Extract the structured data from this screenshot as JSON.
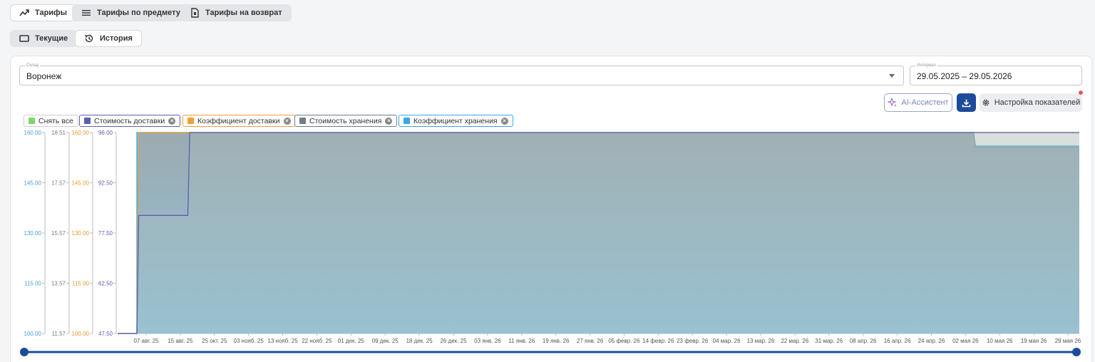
{
  "top_tabs": [
    {
      "label": "Тарифы",
      "icon": "trending-up-icon"
    },
    {
      "label": "Тарифы по предмету",
      "icon": "list-icon"
    },
    {
      "label": "Тарифы на возврат",
      "icon": "document-icon"
    }
  ],
  "sub_tabs": [
    {
      "label": "Текущие",
      "icon": "rectangle-icon"
    },
    {
      "label": "История",
      "icon": "history-icon"
    }
  ],
  "warehouse": {
    "label": "Склад",
    "value": "Воронеж"
  },
  "interval": {
    "label": "Интервал",
    "value": "29.05.2025 – 29.05.2026"
  },
  "buttons": {
    "ai": "AI-Ассистент",
    "settings": "Настройка показателей"
  },
  "legend": [
    {
      "label": "Снять все",
      "color": "#7fd66a",
      "border": "#c9cdd2",
      "removable": false
    },
    {
      "label": "Стоимость доставки",
      "color": "#5b5fb0",
      "border": "#5b5fb0",
      "removable": true
    },
    {
      "label": "Коэффициент доставки",
      "color": "#f0a033",
      "border": "#f0a033",
      "removable": true
    },
    {
      "label": "Стоимость хранения",
      "color": "#6f7f89",
      "border": "#6f7f89",
      "removable": true
    },
    {
      "label": "Коэффициент хранения",
      "color": "#36a9e1",
      "border": "#36a9e1",
      "removable": true
    }
  ],
  "chart_data": {
    "type": "area",
    "x_labels": [
      "07 авг. 25",
      "15 авг. 25",
      "25 окт. 25",
      "03 нояб. 25",
      "13 нояб. 25",
      "22 нояб. 25",
      "01 дек. 25",
      "09 дек. 25",
      "18 дек. 25",
      "26 дек. 25",
      "03 янв. 26",
      "11 янв. 26",
      "19 янв. 26",
      "27 янв. 26",
      "05 февр. 26",
      "14 февр. 26",
      "23 февр. 26",
      "04 мар. 26",
      "13 мар. 26",
      "22 мар. 26",
      "31 мар. 26",
      "08 апр. 26",
      "16 апр. 26",
      "24 апр. 26",
      "02 мая 26",
      "10 мая 26",
      "19 мая 26",
      "29 мая 26"
    ],
    "axes": [
      {
        "series": "Коэффициент хранения",
        "color": "#4a9fd6",
        "ticks": [
          "160.00",
          "145.00",
          "130.00",
          "115.00",
          "100.00"
        ],
        "min": 100,
        "max": 160
      },
      {
        "series": "Стоимость хранения",
        "color": "#6f7f89",
        "ticks": [
          "18.51",
          "17.57",
          "15.57",
          "13.57",
          "11.57"
        ],
        "min": 11.57,
        "max": 18.51
      },
      {
        "series": "Коэффициент доставки",
        "color": "#e99a2e",
        "ticks": [
          "160.00",
          "145.00",
          "130.00",
          "115.00",
          "100.00"
        ],
        "min": 100,
        "max": 160
      },
      {
        "series": "Стоимость доставки",
        "color": "#5b5fb0",
        "ticks": [
          "96.00",
          "92.50",
          "77.50",
          "62.50",
          "47.50"
        ],
        "min": 47.5,
        "max": 96
      }
    ],
    "series": [
      {
        "name": "Коэффициент хранения",
        "color": "#36a9e1",
        "points": [
          [
            0,
            100
          ],
          [
            0.02,
            100
          ],
          [
            0.02,
            160
          ],
          [
            0.89,
            160
          ],
          [
            0.892,
            156
          ],
          [
            1,
            156
          ]
        ]
      },
      {
        "name": "Стоимость хранения",
        "color": "#6f7f89",
        "points": [
          [
            0,
            11.57
          ],
          [
            0.02,
            11.57
          ],
          [
            0.022,
            18.51
          ],
          [
            0.89,
            18.51
          ],
          [
            0.892,
            18.0
          ],
          [
            1,
            18.0
          ]
        ]
      },
      {
        "name": "Коэффициент доставки",
        "color": "#f0a033",
        "points": [
          [
            0,
            100
          ],
          [
            0.02,
            100
          ],
          [
            0.022,
            160
          ],
          [
            1,
            160
          ]
        ]
      },
      {
        "name": "Стоимость доставки",
        "color": "#5b5fb0",
        "points": [
          [
            0,
            47.5
          ],
          [
            0.02,
            47.5
          ],
          [
            0.022,
            76
          ],
          [
            0.073,
            76
          ],
          [
            0.075,
            96
          ],
          [
            1,
            96
          ]
        ]
      }
    ]
  }
}
